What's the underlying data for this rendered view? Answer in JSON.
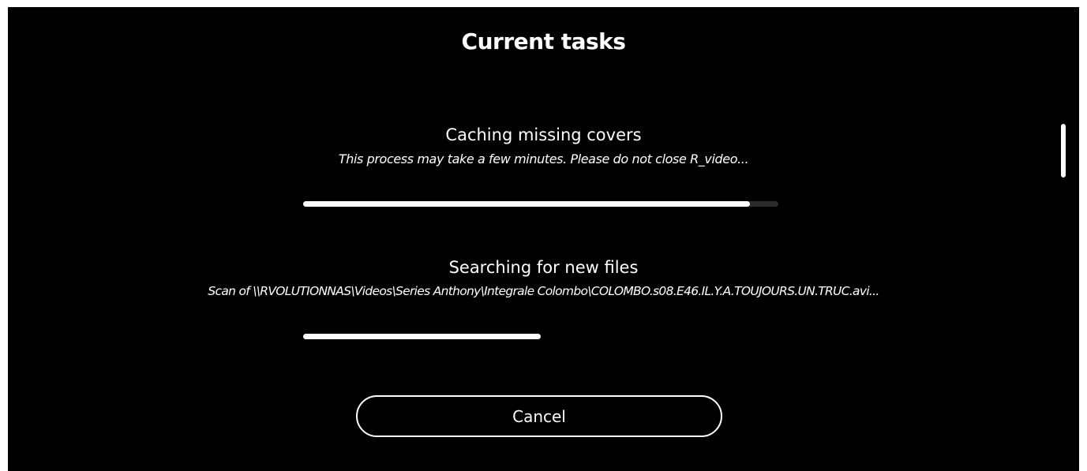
{
  "dialog": {
    "title": "Current tasks",
    "cancel_label": "Cancel"
  },
  "tasks": [
    {
      "title": "Caching missing covers",
      "description": "This process may take a few minutes. Please do not close R_video...",
      "progress": 0.94
    },
    {
      "title": "Searching for new files",
      "description": "Scan of \\\\RVOLUTIONNAS\\Videos\\Series Anthony\\Integrale Colombo\\COLOMBO.s08.E46.IL.Y.A.TOUJOURS.UN.TRUC.avi...",
      "progress": 0.5
    }
  ],
  "colors": {
    "background": "#000000",
    "text": "#ffffff",
    "progress_fill": "#ffffff",
    "progress_track": "#2b2b2b"
  }
}
